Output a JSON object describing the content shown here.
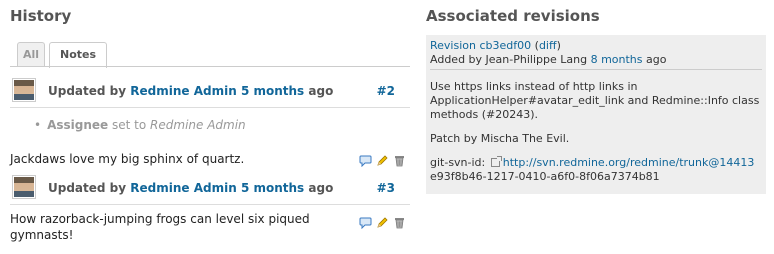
{
  "history": {
    "title": "History",
    "tabs": [
      {
        "label": "All",
        "selected": false
      },
      {
        "label": "Notes",
        "selected": true
      }
    ],
    "journals": [
      {
        "prefix": "Updated by",
        "author": "Redmine Admin",
        "time": "5 months",
        "suffix": "ago",
        "number": "#2",
        "detail_field": "Assignee",
        "detail_verb": "set to",
        "detail_value": "Redmine Admin",
        "note": "Jackdaws love my big sphinx of quartz."
      },
      {
        "prefix": "Updated by",
        "author": "Redmine Admin",
        "time": "5 months",
        "suffix": "ago",
        "number": "#3",
        "note": "How razorback-jumping frogs can level six piqued gymnasts!"
      }
    ]
  },
  "revisions": {
    "title": "Associated revisions",
    "revision_label": "Revision",
    "revision_id": "cb3edf00",
    "diff_label": "diff",
    "added_by_prefix": "Added by",
    "added_by_author": "Jean-Philippe Lang",
    "added_time": "8 months",
    "added_suffix": "ago",
    "message": "Use https links instead of http links in ApplicationHelper#avatar_edit_link and Redmine::Info class methods (#20243).",
    "patch_note": "Patch by Mischa The Evil.",
    "svn_label": "git-svn-id:",
    "svn_url": "http://svn.redmine.org/redmine/trunk@14413",
    "svn_hash": "e93f8b46-1217-0410-a6f0-8f06a7374b81"
  },
  "colors": {
    "link": "#116699",
    "revision_box": "#eeeeee",
    "heading": "#555555",
    "edit_pencil": "#e6b800",
    "quote_icon": "#3a7ac2"
  },
  "icons": [
    "comment-icon",
    "edit-icon",
    "delete-icon",
    "external-link-icon",
    "avatar"
  ]
}
